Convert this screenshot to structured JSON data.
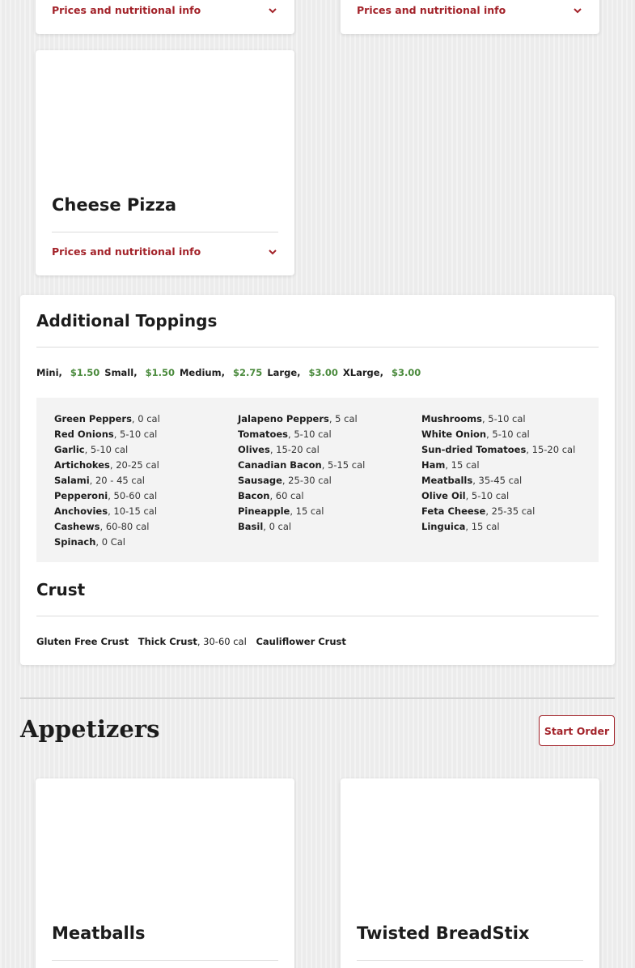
{
  "cards_top": [
    {
      "info_label": "Prices and nutritional info"
    },
    {
      "info_label": "Prices and nutritional info"
    }
  ],
  "cheese_card": {
    "title": "Cheese Pizza",
    "info_label": "Prices and nutritional info"
  },
  "toppings": {
    "heading": "Additional Toppings",
    "sizes": [
      {
        "label": "Mini",
        "price": "$1.50"
      },
      {
        "label": "Small",
        "price": "$1.50"
      },
      {
        "label": "Medium",
        "price": "$2.75"
      },
      {
        "label": "Large",
        "price": "$3.00"
      },
      {
        "label": "XLarge",
        "price": "$3.00"
      }
    ],
    "columns": [
      [
        {
          "name": "Green Peppers",
          "cal": ", 0 cal"
        },
        {
          "name": "Red Onions",
          "cal": ", 5-10 cal"
        },
        {
          "name": "Garlic",
          "cal": ", 5-10 cal"
        },
        {
          "name": "Artichokes",
          "cal": ", 20-25 cal"
        },
        {
          "name": "Salami",
          "cal": ", 20 - 45 cal"
        },
        {
          "name": "Pepperoni",
          "cal": ", 50-60 cal"
        },
        {
          "name": "Anchovies",
          "cal": ", 10-15 cal"
        },
        {
          "name": "Cashews",
          "cal": ", 60-80 cal"
        },
        {
          "name": "Spinach",
          "cal": ", 0 Cal"
        }
      ],
      [
        {
          "name": "Jalapeno Peppers",
          "cal": ", 5 cal"
        },
        {
          "name": "Tomatoes",
          "cal": ", 5-10 cal"
        },
        {
          "name": "Olives",
          "cal": ", 15-20 cal"
        },
        {
          "name": "Canadian Bacon",
          "cal": ", 5-15 cal"
        },
        {
          "name": "Sausage",
          "cal": ", 25-30 cal"
        },
        {
          "name": "Bacon",
          "cal": ", 60 cal"
        },
        {
          "name": "Pineapple",
          "cal": ", 15 cal"
        },
        {
          "name": "Basil",
          "cal": ", 0 cal"
        }
      ],
      [
        {
          "name": "Mushrooms",
          "cal": ", 5-10 cal"
        },
        {
          "name": "White Onion",
          "cal": ", 5-10 cal"
        },
        {
          "name": "Sun-dried Tomatoes",
          "cal": ", 15-20 cal"
        },
        {
          "name": "Ham",
          "cal": ", 15 cal"
        },
        {
          "name": "Meatballs",
          "cal": ", 35-45 cal"
        },
        {
          "name": "Olive Oil",
          "cal": ", 5-10 cal"
        },
        {
          "name": "Feta Cheese",
          "cal": ", 25-35 cal"
        },
        {
          "name": "Linguica",
          "cal": ", 15 cal"
        }
      ]
    ]
  },
  "crust": {
    "heading": "Crust",
    "items": [
      {
        "name": "Gluten Free Crust",
        "cal": ""
      },
      {
        "name": "Thick Crust",
        "cal": ", 30-60 cal"
      },
      {
        "name": "Cauliflower Crust",
        "cal": ""
      }
    ]
  },
  "appetizers": {
    "heading": "Appetizers",
    "start_order": "Start Order",
    "cards": [
      {
        "title": "Meatballs"
      },
      {
        "title": "Twisted BreadStix"
      }
    ]
  },
  "colors": {
    "accent": "#a3232a",
    "price": "#4a8a3c"
  }
}
